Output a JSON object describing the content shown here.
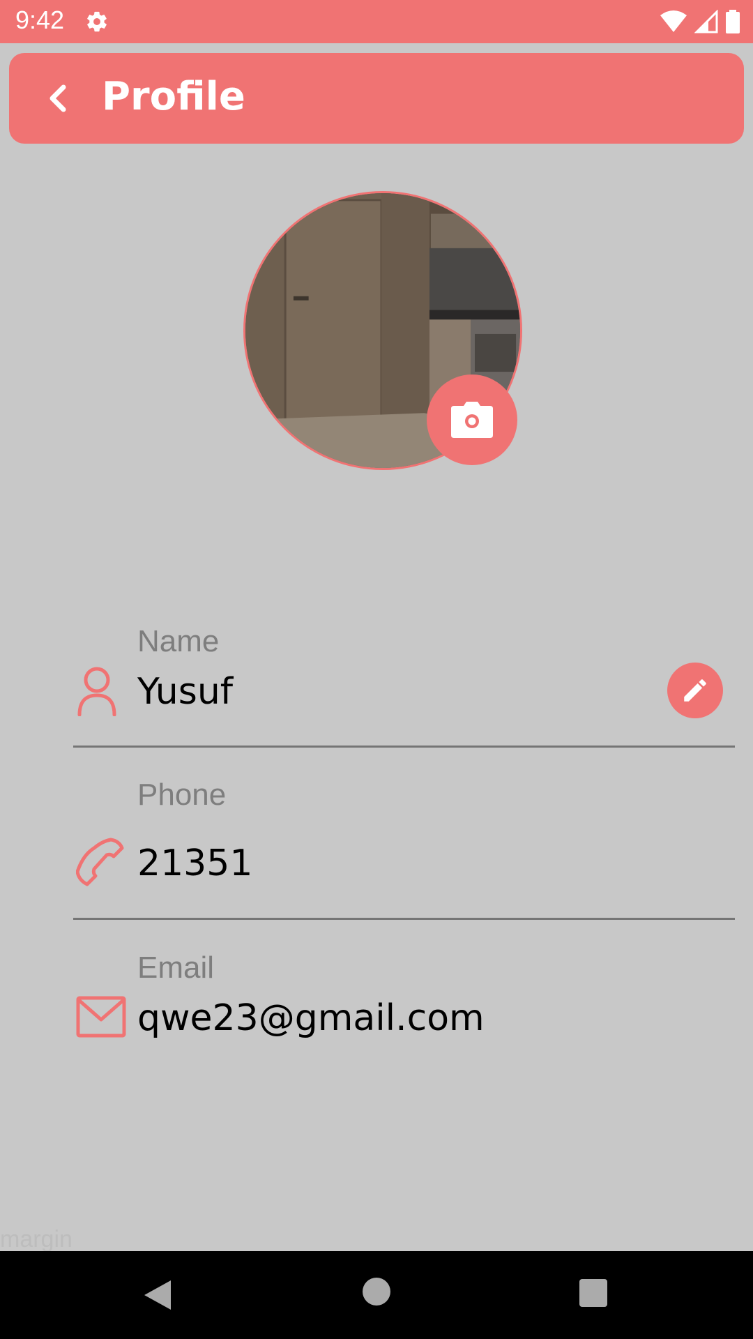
{
  "status_bar": {
    "time": "9:42",
    "icons": [
      "gear-icon",
      "wifi-icon",
      "signal-icon",
      "battery-icon"
    ]
  },
  "app_bar": {
    "title": "Profile",
    "back_icon": "chevron-left-icon"
  },
  "avatar": {
    "camera_icon": "camera-icon"
  },
  "fields": {
    "name": {
      "label": "Name",
      "value": "Yusuf",
      "icon": "person-icon",
      "action_icon": "pencil-icon"
    },
    "phone": {
      "label": "Phone",
      "value": "21351",
      "icon": "phone-icon"
    },
    "email": {
      "label": "Email",
      "value": "qwe23@gmail.com",
      "icon": "mail-icon"
    }
  },
  "footer_text": "margin",
  "nav_bar": {
    "icons": [
      "back-triangle-icon",
      "home-circle-icon",
      "recents-square-icon"
    ]
  },
  "colors": {
    "accent": "#f07373",
    "background": "#c8c8c8",
    "label": "#7e7e7e",
    "divider": "#757575"
  }
}
